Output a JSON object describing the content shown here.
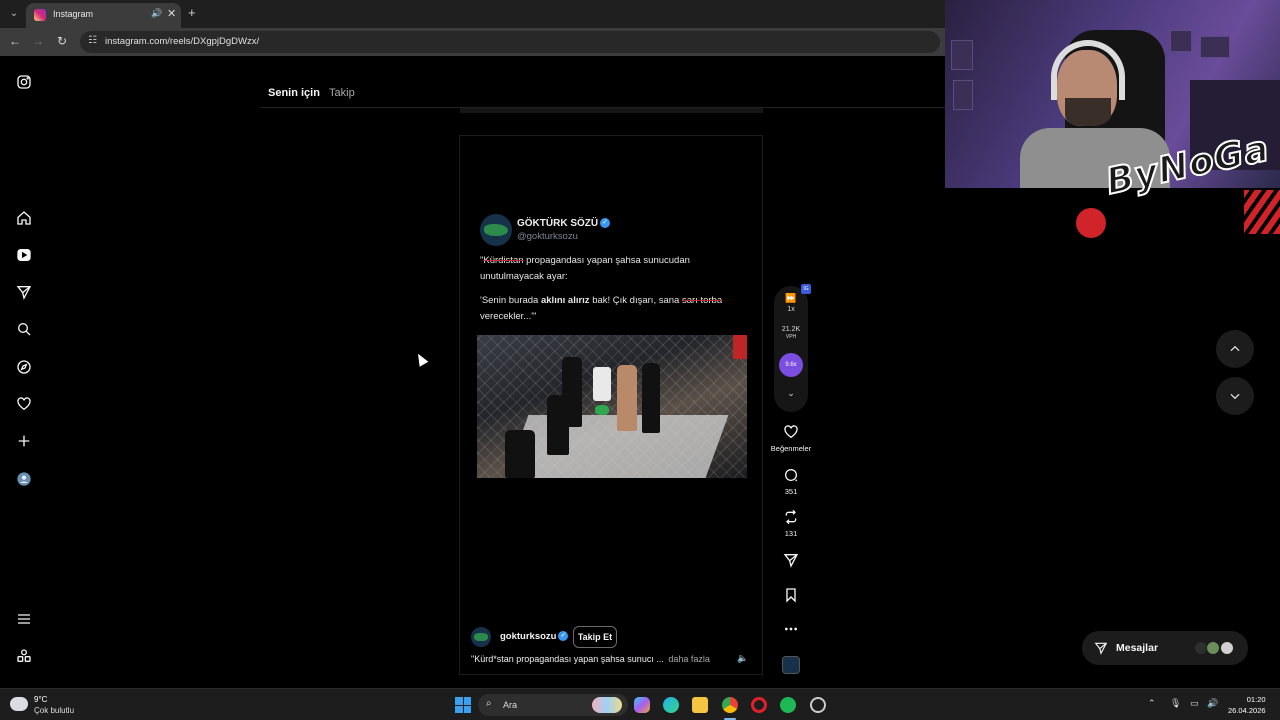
{
  "browser": {
    "tab_title": "Instagram",
    "url": "instagram.com/reels/DXgpjDgDWzx/"
  },
  "instagram": {
    "feed_tabs": [
      {
        "label": "Senin için",
        "active": true
      },
      {
        "label": "Takip",
        "active": false
      }
    ],
    "reel": {
      "tweet": {
        "author": "GÖKTÜRK SÖZÜ",
        "handle": "@gokturksozu",
        "line1_struck": "Kürdistan",
        "line1_rest": " propagandası yapan şahsa sunucudan",
        "line2": "unutulmayacak ayar:",
        "line3_pre": "'Senin burada ",
        "line3_bold": "aklını alırız",
        "line3_mid": " bak! Çık dışarı, sana ",
        "line3_struck": "sarı torba",
        "line4": "verecekler...'\""
      },
      "username": "gokturksozu",
      "follow_label": "Takip Et",
      "caption": "\"Kürd*stan propagandası yapan şahsa sunucı ...",
      "more_label": "daha fazla"
    },
    "extension": {
      "speed": "1x",
      "vph_value": "21.2K",
      "vph_label": "VPH",
      "multiplier": "9.6x"
    },
    "actions": {
      "likes_label": "Beğenmeler",
      "comments": "351",
      "reposts": "131"
    },
    "messages_label": "Mesajlar"
  },
  "overlay": {
    "brand": "ByNoGa"
  },
  "taskbar": {
    "temperature": "9°C",
    "weather": "Çok bulutlu",
    "search_placeholder": "Ara",
    "time": "01:20",
    "date": "26.04.2026"
  }
}
